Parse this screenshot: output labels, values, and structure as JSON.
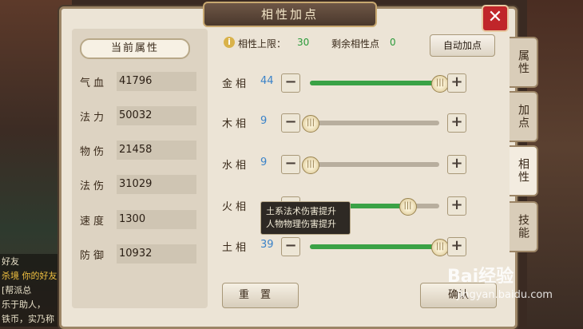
{
  "window": {
    "title": "相性加点",
    "close_label": "✕"
  },
  "attributes": {
    "header": "当前属性",
    "items": [
      {
        "label": "气血",
        "value": "41796"
      },
      {
        "label": "法力",
        "value": "50032"
      },
      {
        "label": "物伤",
        "value": "21458"
      },
      {
        "label": "法伤",
        "value": "31029"
      },
      {
        "label": "速度",
        "value": "1300"
      },
      {
        "label": "防御",
        "value": "10932"
      }
    ]
  },
  "points": {
    "limit_label": "相性上限：",
    "limit_value": "30",
    "remaining_label": "剩余相性点",
    "remaining_value": "0",
    "auto_button": "自动加点"
  },
  "elements": [
    {
      "label": "金相",
      "value": "44",
      "fill": 1.0
    },
    {
      "label": "木相",
      "value": "9",
      "fill": 0.0
    },
    {
      "label": "水相",
      "value": "9",
      "fill": 0.0
    },
    {
      "label": "火相",
      "value": "",
      "fill": 0.75
    },
    {
      "label": "土相",
      "value": "39",
      "fill": 1.0
    }
  ],
  "tooltip": {
    "line1": "土系法术伤害提升",
    "line2": "人物物理伤害提升"
  },
  "buttons": {
    "reset": "重置",
    "confirm": "确认"
  },
  "side_tabs": [
    "属性",
    "加点",
    "相性",
    "技能"
  ],
  "chat": {
    "friend": "好友",
    "line1": "杀境 你的好友",
    "line2": "[帮派总",
    "line3": "乐于助人，",
    "line4": "铁币，实乃称"
  },
  "watermark": {
    "logo": "Bai经验",
    "url": "jingyan.baidu.com"
  },
  "colors": {
    "accent_green": "#3aa246",
    "value_blue": "#3a82c8",
    "close_red": "#c0262a"
  }
}
